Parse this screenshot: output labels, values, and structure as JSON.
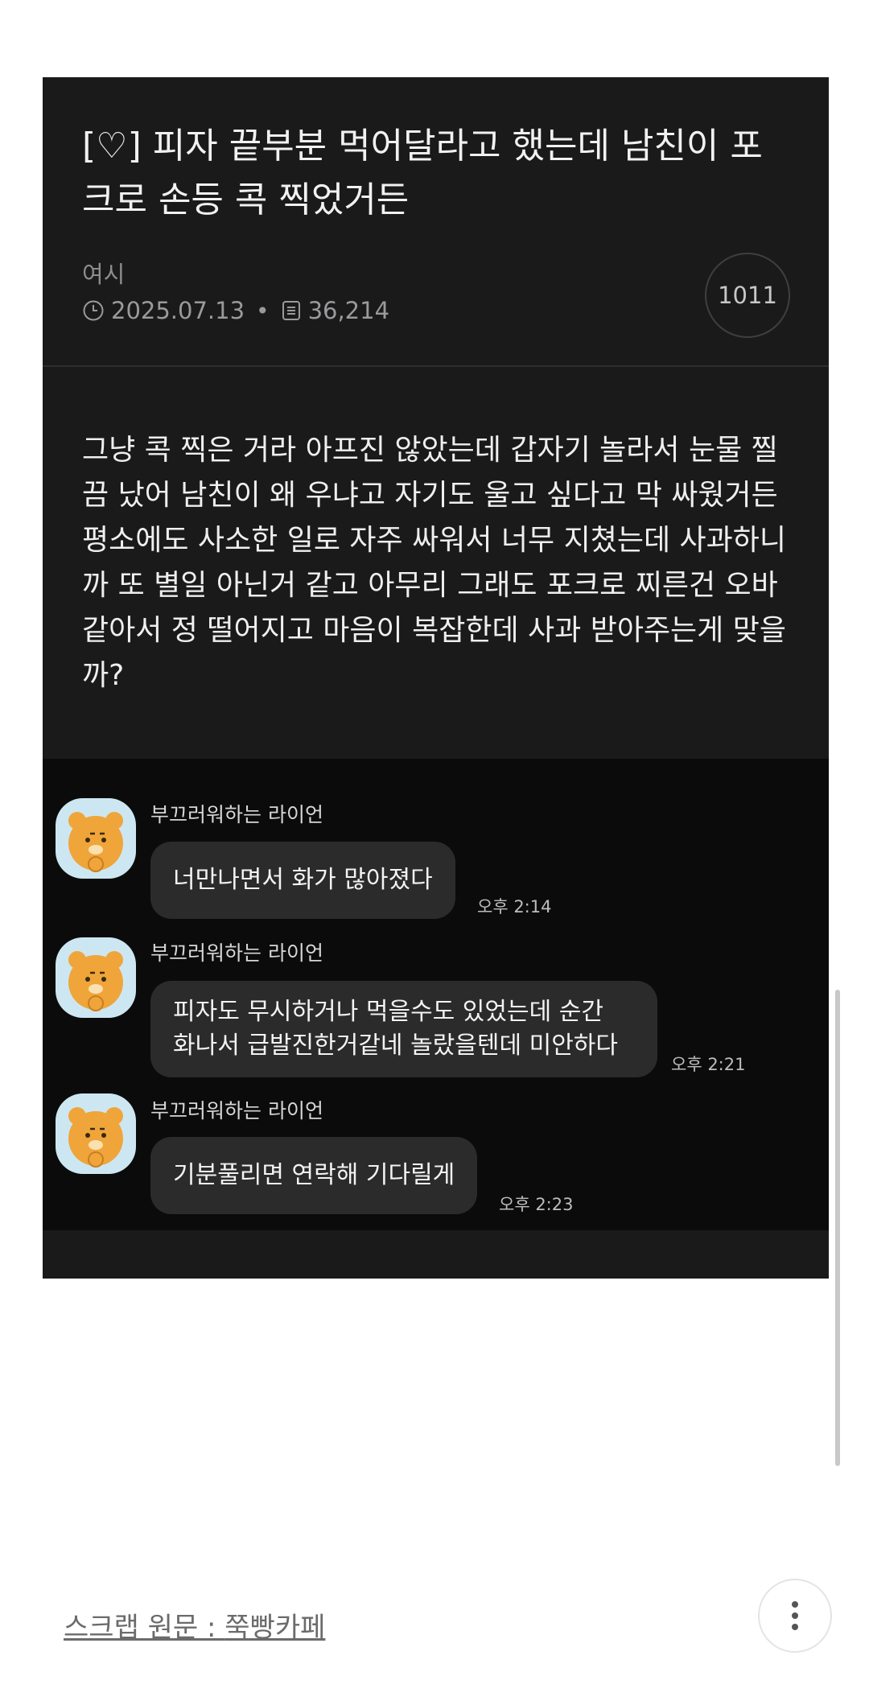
{
  "post": {
    "title": "[♡] 피자 끝부분 먹어달라고 했는데 남친이 포크로 손등 콕 찍었거든",
    "author": "여시",
    "date": "2025.07.13",
    "views": "36,214",
    "comment_count": "1011",
    "body": "그냥 콕 찍은 거라 아프진 않았는데 갑자기 놀라서 눈물 찔끔 났어 남친이 왜 우냐고 자기도 울고 싶다고 막 싸웠거든 평소에도 사소한 일로 자주 싸워서 너무 지쳤는데 사과하니까 또 별일 아닌거 같고 아무리 그래도 포크로 찌른건 오바 같아서 정 떨어지고 마음이 복잡한데 사과 받아주는게 맞을까?"
  },
  "chat": {
    "messages": [
      {
        "sender": "부끄러워하는 라이언",
        "lines": [
          "너만나면서 화가 많아졌다"
        ],
        "time": "오후 2:14"
      },
      {
        "sender": "부끄러워하는 라이언",
        "lines": [
          "피자도 무시하거나 먹을수도 있었는데 순간",
          "화나서 급발진한거같네 놀랐을텐데 미안하다"
        ],
        "time": "오후 2:21"
      },
      {
        "sender": "부끄러워하는 라이언",
        "lines": [
          "기분풀리면 연락해 기다릴게"
        ],
        "time": "오후 2:23"
      }
    ]
  },
  "footer": {
    "source_prefix": "스크랩 원문 : ",
    "source_name": "쭉빵카페"
  },
  "colors": {
    "card_bg": "#1a1a1b",
    "chat_bg": "#0b0b0b",
    "bubble_bg": "#2b2b2b",
    "avatar_bg": "#cde7f2",
    "ryan": "#f0a53a"
  },
  "icons": [
    "clock-icon",
    "views-icon",
    "more-vertical-icon",
    "ryan-avatar-icon"
  ]
}
